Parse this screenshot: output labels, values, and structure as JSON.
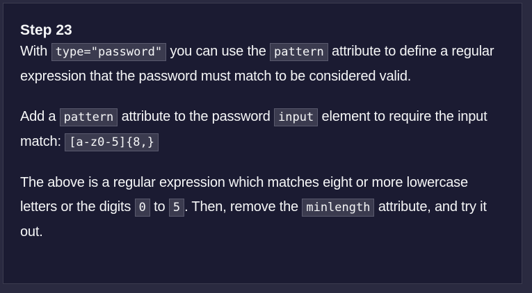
{
  "step": {
    "title": "Step 23",
    "p1": {
      "t1": "With ",
      "c1": "type=\"password\"",
      "t2": " you can use the ",
      "c2": "pattern",
      "t3": " attribute to define a regular expression that the password must match to be considered valid."
    },
    "p2": {
      "t1": "Add a ",
      "c1": "pattern",
      "t2": " attribute to the password ",
      "c2": "input",
      "t3": " element to require the input match: ",
      "c3": "[a-z0-5]{8,}"
    },
    "p3": {
      "t1": "The above is a regular expression which matches eight or more lowercase letters or the digits ",
      "c1": "0",
      "t2": " to ",
      "c2": "5",
      "t3": ". Then, remove the ",
      "c3": "minlength",
      "t4": " attribute, and try it out."
    }
  }
}
